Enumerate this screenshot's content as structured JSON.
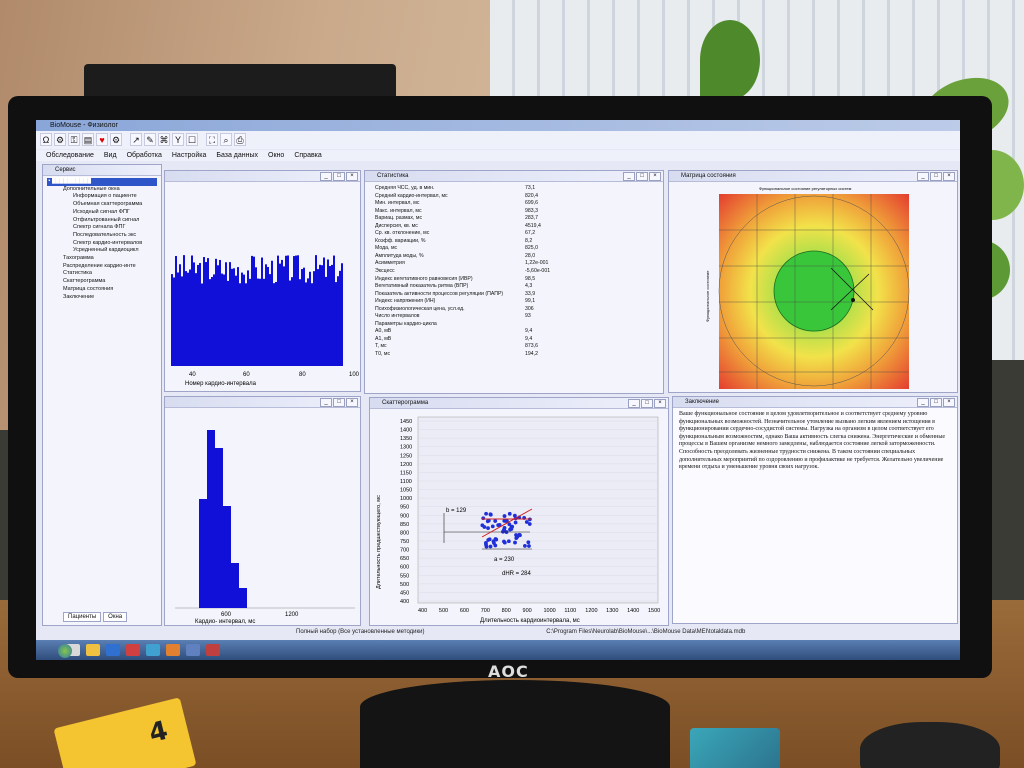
{
  "app": {
    "title": "BioMouse - Физиолог"
  },
  "toolbar": {
    "icons": [
      "icon-1",
      "icon-2",
      "icon-3",
      "heart-icon",
      "icon-5",
      "icon-6",
      "icon-7",
      "icon-8",
      "icon-9",
      "icon-10",
      "icon-11",
      "icon-12",
      "icon-13",
      "icon-14"
    ]
  },
  "menu": {
    "items": [
      "Обследование",
      "Вид",
      "Обработка",
      "Настройка",
      "База данных",
      "Окно",
      "Справка"
    ]
  },
  "sidebar": {
    "title": "Сервис",
    "items": [
      "Дополнительные окна",
      "Информация о пациенте",
      "Объемная скаттерограмма",
      "Исходный сигнал ФПГ",
      "Отфильтрованный сигнал",
      "Спектр сигнала ФПГ",
      "Последовательность экс",
      "Спектр кардио-интервалов",
      "Усредненный кардиоцикл",
      "Тахограмма",
      "Распределение кардио-инте",
      "Статистика",
      "Скаттерограмма",
      "Матрица состояния",
      "Заключение"
    ],
    "tabs": [
      "Пациенты",
      "Окна"
    ]
  },
  "stats": {
    "title": "Статистика",
    "rows": [
      [
        "Средняя ЧСС, уд. в мин.",
        "73,1"
      ],
      [
        "Средний кардио-интервал, мс",
        "820,4"
      ],
      [
        "Мин. интервал, мс",
        "699,6"
      ],
      [
        "Макс. интервал, мс",
        "983,3"
      ],
      [
        "Вариац. размах, мс",
        "283,7"
      ],
      [
        "Дисперсия, кв. мс",
        "4519,4"
      ],
      [
        "Ср. кв. отклонение, мс",
        "67,2"
      ],
      [
        "Коэфф. вариации, %",
        "8,2"
      ],
      [
        "Мода, мс",
        "825,0"
      ],
      [
        "Амплитуда моды, %",
        "28,0"
      ],
      [
        "Асимметрия",
        "1,22e-001"
      ],
      [
        "Эксцесс",
        "-5,60e-001"
      ],
      [
        "",
        ""
      ],
      [
        "Индекс вегетативного равновесия (ИВР)",
        "98,5"
      ],
      [
        "Вегетативный показатель ритма (ВПР)",
        "4,3"
      ],
      [
        "Показатель активности процессов регуляции (ПАПР)",
        "33,9"
      ],
      [
        "Индекс напряжения (ИН)",
        "99,1"
      ],
      [
        "",
        ""
      ],
      [
        "Психофизиологическая цена, усл.ед.",
        "306"
      ],
      [
        "",
        ""
      ],
      [
        "Число интервалов",
        "93"
      ],
      [
        "",
        ""
      ],
      [
        "Параметры кардио-цикла",
        ""
      ],
      [
        "A0, мВ",
        "9,4"
      ],
      [
        "A1, мВ",
        "9,4"
      ],
      [
        "T, мс",
        "873,6"
      ],
      [
        "T0, мс",
        "194,2"
      ]
    ]
  },
  "hist1": {
    "x_labels": [
      "40",
      "60",
      "80",
      "100"
    ],
    "xlabel": "Номер кардио-интервала"
  },
  "hist2": {
    "x_labels": [
      "600",
      "1200"
    ],
    "xlabel": "Кардио- интервал, мс"
  },
  "scatter": {
    "title": "Скаттерограмма",
    "ylabel": "Длительность предшествующего, мс",
    "xlabel": "Длительность кардиоинтервала, мс",
    "y_ticks": [
      "1450",
      "1400",
      "1350",
      "1300",
      "1250",
      "1200",
      "1150",
      "1100",
      "1050",
      "1000",
      "950",
      "900",
      "850",
      "800",
      "750",
      "700",
      "650",
      "600",
      "550",
      "500",
      "450",
      "400"
    ],
    "x_ticks": [
      "400",
      "500",
      "600",
      "700",
      "800",
      "900",
      "1000",
      "1100",
      "1200",
      "1300",
      "1400",
      "1500"
    ],
    "labels": {
      "b": "b = 129",
      "a": "a = 230",
      "dhr": "dHR = 284"
    }
  },
  "matrix": {
    "title": "Матрица состояния",
    "top_label": "Функциональное состояние регуляторных систем",
    "side_label": "Функциональное состояние"
  },
  "conclusion": {
    "title": "Заключение",
    "text": "Ваше функциональное состояние в целом удовлетворительное и соответствует среднему уровню функциональных возможностей. Незначительное утомление вызвано легким явлением истощения в функционировании сердечно-сосудистой системы. Нагрузка на организм в целом соответствует его функциональным возможностям, однако Ваша активность слегка снижена. Энергетические и обменные процессы в Вашем организме немного замедлены, наблюдается состояние легкой заторможенности. Способность преодолевать жизненные трудности снижена. В таком состоянии специальных дополнительных мероприятий по оздоровлению и профилактике не требуется. Желательно увеличение времени отдыха и уменьшение уровня своих нагрузок."
  },
  "status": {
    "left": "Полный набор (Все установленные методики)",
    "path": "C:\\Program Files\\Neurolab\\BioMouse\\...\\BioMouse Data\\MEI\\totaldata.mdb"
  },
  "monitor": {
    "brand": "AOC"
  },
  "desk": {
    "card_number": "4"
  }
}
